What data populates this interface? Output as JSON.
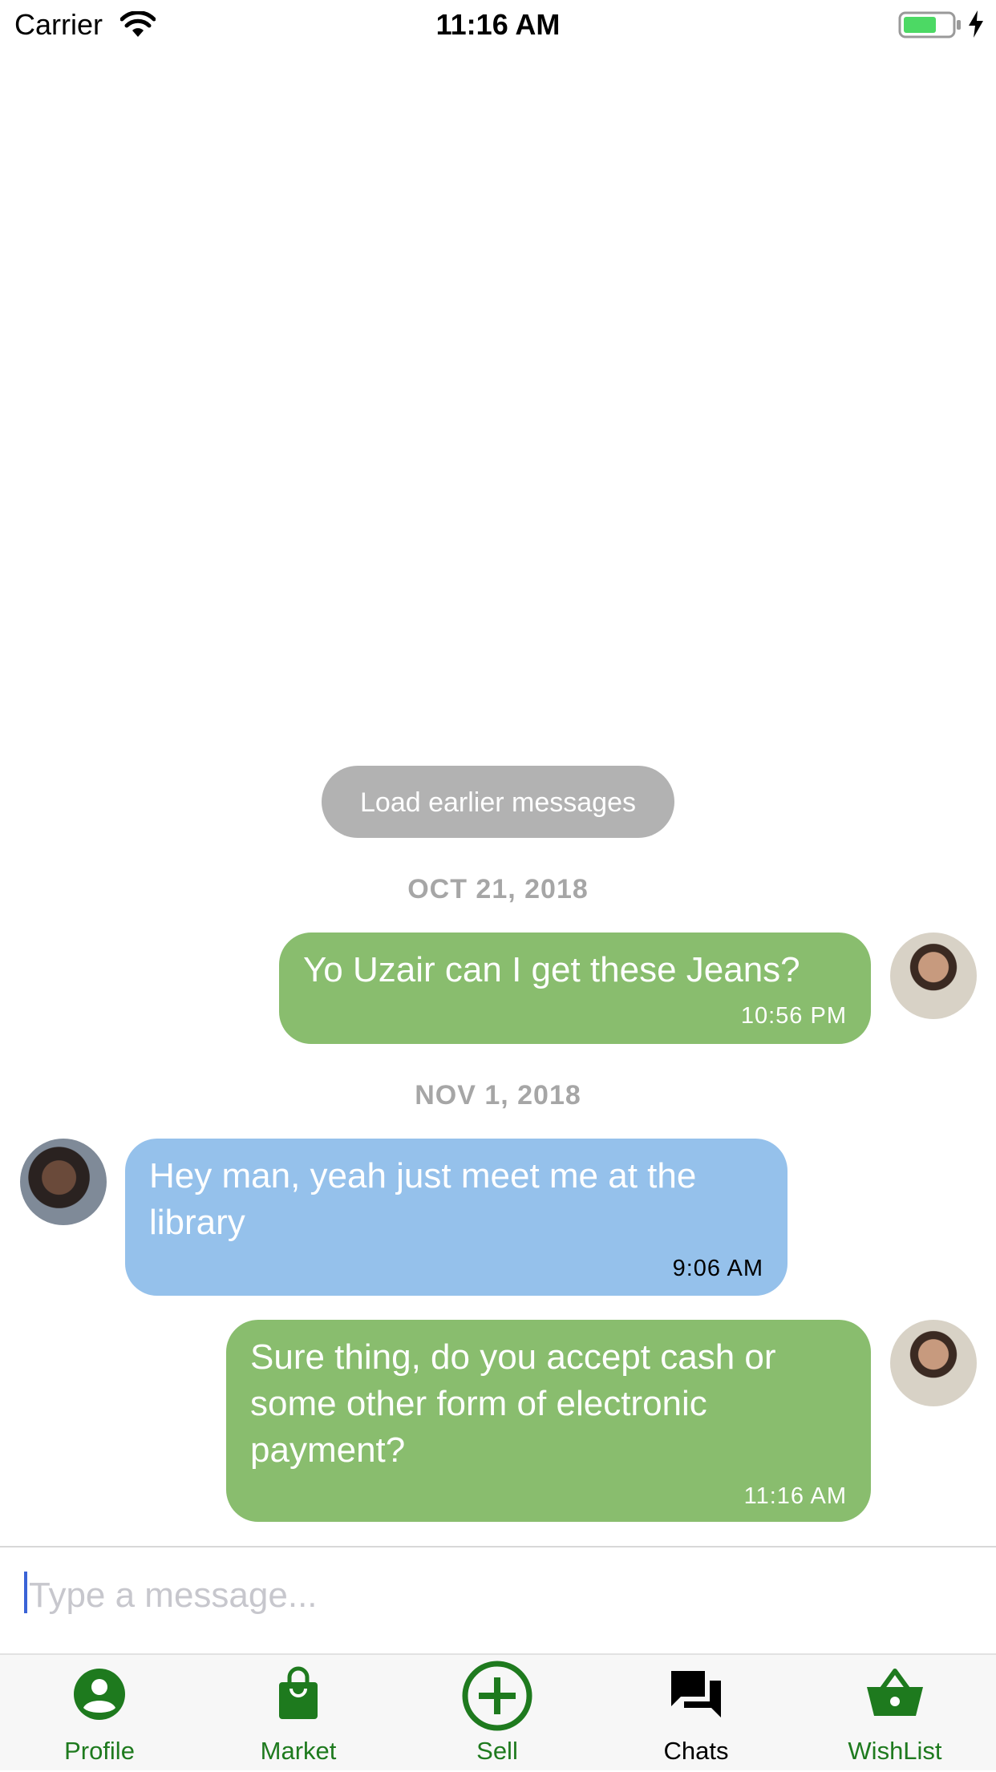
{
  "status_bar": {
    "carrier": "Carrier",
    "time": "11:16 AM"
  },
  "chat": {
    "load_earlier": "Load earlier messages",
    "days": [
      "OCT 21, 2018",
      "NOV 1, 2018"
    ],
    "messages": [
      {
        "text": "Yo Uzair can I get these Jeans?",
        "time": "10:56 PM",
        "side": "outgoing"
      },
      {
        "text": "Hey man, yeah just meet me at the library",
        "time": "9:06 AM",
        "side": "incoming"
      },
      {
        "text": "Sure thing, do you accept cash or some other form of electronic payment?",
        "time": "11:16 AM",
        "side": "outgoing"
      }
    ]
  },
  "composer": {
    "placeholder": "Type a message..."
  },
  "tab_bar": {
    "active": "Chats",
    "tabs": [
      {
        "label": "Profile",
        "icon": "account-circle-icon"
      },
      {
        "label": "Market",
        "icon": "shopping-bag-icon"
      },
      {
        "label": "Sell",
        "icon": "plus-circle-icon"
      },
      {
        "label": "Chats",
        "icon": "forum-icon"
      },
      {
        "label": "WishList",
        "icon": "basket-icon"
      }
    ]
  },
  "colors": {
    "outgoing_bubble": "#89bd6e",
    "incoming_bubble": "#95c1eb",
    "tab_green": "#1e7a1e",
    "load_earlier_bg": "#b2b2b2"
  }
}
